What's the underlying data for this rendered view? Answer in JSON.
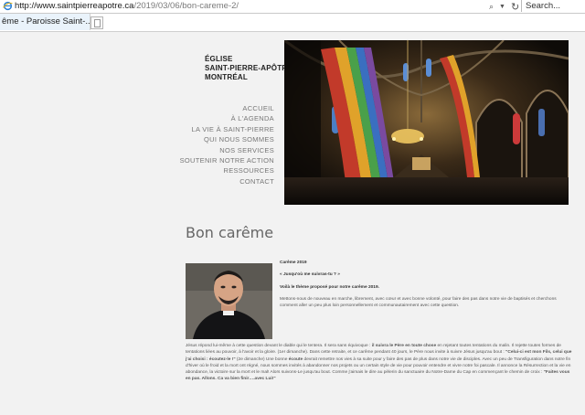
{
  "browser": {
    "url_domain": "http://www.saintpierreapotre.ca",
    "url_path": "/2019/03/06/bon-careme-2/",
    "search_placeholder": "Search...",
    "tab_title": "ême - Paroisse Saint-...",
    "refresh_icon": "refresh-icon",
    "dropdown_icon": "chevron-down-icon"
  },
  "site": {
    "title_line1": "ÉGLISE",
    "title_line2": "SAINT-PIERRE-APÔTRE",
    "title_line3": "MONTRÉAL"
  },
  "nav": {
    "items": [
      {
        "label": "ACCUEIL"
      },
      {
        "label": "À L'AGENDA"
      },
      {
        "label": "LA VIE À SAINT-PIERRE"
      },
      {
        "label": "QUI NOUS SOMMES"
      },
      {
        "label": "NOS SERVICES"
      },
      {
        "label": "SOUTENIR NOTRE ACTION"
      },
      {
        "label": "RESSOURCES"
      },
      {
        "label": "CONTACT"
      }
    ]
  },
  "post": {
    "title": "Bon carême",
    "heading1": "Carême 2019",
    "heading2": "« Jusqu'où me suivras-tu ? »",
    "heading3": "Voilà le thème proposé pour notre carême 2019.",
    "para1": "Mettons-nous de nouveau en marche, librement, avec cœur et avec bonne volonté, pour faire des pas dans notre vie de baptisés et cherchons comment aller un peu plus loin personnellement et communautairement avec cette question.",
    "para2_a": "Jésus répond lui-même à cette question devant le diable qui le tentera. Il sera sans équivoque : ",
    "para2_b": "il suivra le Père en toute chose",
    "para2_c": " en rejetant toutes tentations du malin. Il rejette toutes formes de tentations liées au pouvoir, à l'avoir et la gloire. (1er dimanche). Dans cette retraite, et ce carême pendant 40 jours, le Père nous invite à suivre Jésus jusqu'au bout : ",
    "para2_d": "\"Celui-ci est mon Fils, celui que j'ai choisi : écoutez-le !\"",
    "para2_e": " (2e dimanche) Une bonne ",
    "para2_f": "écoute",
    "para2_g": " devrait remettre nos vies à sa suite pour y faire des pas de plus dans notre vie de disciples. Avec un peu de Transfiguration dans notre fin d'hiver où le froid et la mort ont régné, nous sommes invités à abandonner nos projets ou un certain style de vie pour pouvoir entendre et vivre notre foi pascale. Il annonce la Résurrection et la vie en abondance, la victoire sur la mort et le mal! Alors suivons-Le jusqu'au bout. Comme j'aimais le dire au pèlerin du sanctuaire du Notre-Dame du Cap en commençant le chemin de croix : ",
    "para2_h": "\"Faites vous en pas. Allons. Ca va bien finir….avec Lui!\""
  },
  "colors": {
    "page_bg": "#f2f2f2",
    "nav_text": "#777777",
    "heading_text": "#666666"
  }
}
